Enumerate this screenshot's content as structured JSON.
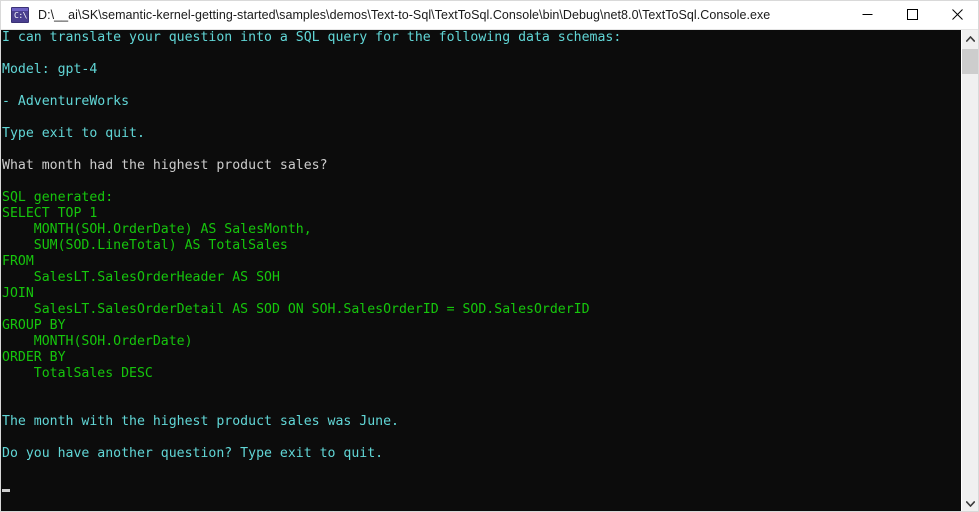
{
  "window": {
    "title": "D:\\__ai\\SK\\semantic-kernel-getting-started\\samples\\demos\\Text-to-Sql\\TextToSql.Console\\bin\\Debug\\net8.0\\TextToSql.Console.exe",
    "icon_glyph": "C:\\",
    "icon_name": "console-app-icon",
    "controls": {
      "minimize": "Minimize",
      "maximize": "Maximize",
      "close": "Close"
    }
  },
  "colors": {
    "background": "#0c0c0c",
    "cyan": "#61d6d6",
    "green": "#16c60c",
    "white": "#cccccc",
    "titlebar": "#ffffff",
    "scrollbar_track": "#f0f0f0",
    "scrollbar_thumb": "#cdcdcd"
  },
  "console": {
    "lines": [
      {
        "text": "I can translate your question into a SQL query for the following data schemas:",
        "color": "cyan"
      },
      {
        "text": "",
        "color": "cyan"
      },
      {
        "text": "Model: gpt-4",
        "color": "cyan"
      },
      {
        "text": "",
        "color": "cyan"
      },
      {
        "text": "- AdventureWorks",
        "color": "cyan"
      },
      {
        "text": "",
        "color": "cyan"
      },
      {
        "text": "Type exit to quit.",
        "color": "cyan"
      },
      {
        "text": "",
        "color": "cyan"
      },
      {
        "text": "What month had the highest product sales?",
        "color": "white"
      },
      {
        "text": "",
        "color": "white"
      },
      {
        "text": "SQL generated:",
        "color": "green"
      },
      {
        "text": "SELECT TOP 1",
        "color": "green"
      },
      {
        "text": "    MONTH(SOH.OrderDate) AS SalesMonth,",
        "color": "green"
      },
      {
        "text": "    SUM(SOD.LineTotal) AS TotalSales",
        "color": "green"
      },
      {
        "text": "FROM",
        "color": "green"
      },
      {
        "text": "    SalesLT.SalesOrderHeader AS SOH",
        "color": "green"
      },
      {
        "text": "JOIN",
        "color": "green"
      },
      {
        "text": "    SalesLT.SalesOrderDetail AS SOD ON SOH.SalesOrderID = SOD.SalesOrderID",
        "color": "green"
      },
      {
        "text": "GROUP BY",
        "color": "green"
      },
      {
        "text": "    MONTH(SOH.OrderDate)",
        "color": "green"
      },
      {
        "text": "ORDER BY",
        "color": "green"
      },
      {
        "text": "    TotalSales DESC",
        "color": "green"
      },
      {
        "text": "",
        "color": "green"
      },
      {
        "text": "",
        "color": "green"
      },
      {
        "text": "The month with the highest product sales was June.",
        "color": "cyan"
      },
      {
        "text": "",
        "color": "cyan"
      },
      {
        "text": "Do you have another question? Type exit to quit.",
        "color": "cyan"
      }
    ],
    "prompt_value": ""
  },
  "scrollbar": {
    "up_arrow": "▲",
    "down_arrow": "▼"
  }
}
